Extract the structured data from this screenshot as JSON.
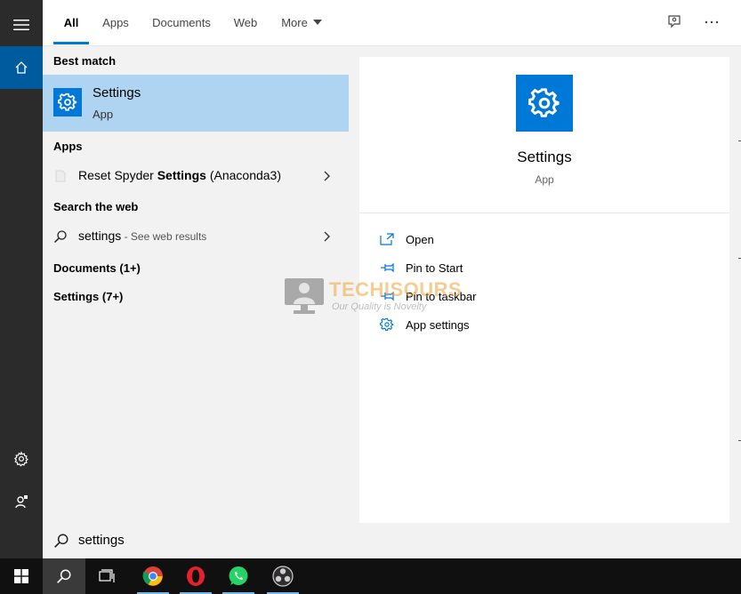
{
  "tabs": [
    {
      "label": "All",
      "active": true
    },
    {
      "label": "Apps"
    },
    {
      "label": "Documents"
    },
    {
      "label": "Web"
    },
    {
      "label": "More"
    }
  ],
  "results": {
    "best_match_title": "Best match",
    "best_match": {
      "title": "Settings",
      "subtitle": "App",
      "icon": "gear-icon"
    },
    "apps_title": "Apps",
    "app_item": {
      "prefix": "Reset Spyder ",
      "bold": "Settings",
      "suffix": " (Anaconda3)"
    },
    "web_title": "Search the web",
    "web_item": {
      "term": "settings",
      "hint": " - See web results"
    },
    "documents_label": "Documents (1+)",
    "settings_label": "Settings (7+)"
  },
  "detail": {
    "title": "Settings",
    "subtitle": "App",
    "actions": [
      {
        "label": "Open",
        "icon": "open-icon"
      },
      {
        "label": "Pin to Start",
        "icon": "pin-icon"
      },
      {
        "label": "Pin to taskbar",
        "icon": "pin-taskbar-icon"
      },
      {
        "label": "App settings",
        "icon": "gear-icon"
      }
    ]
  },
  "watermark": {
    "brand": "TECHISOURS",
    "tagline": "Our Quality is Novelty"
  },
  "search": {
    "value": "settings"
  },
  "colors": {
    "accent": "#0078d7",
    "selected": "#aed4f2",
    "rail": "#2b2b2b",
    "taskbar": "#101010"
  }
}
